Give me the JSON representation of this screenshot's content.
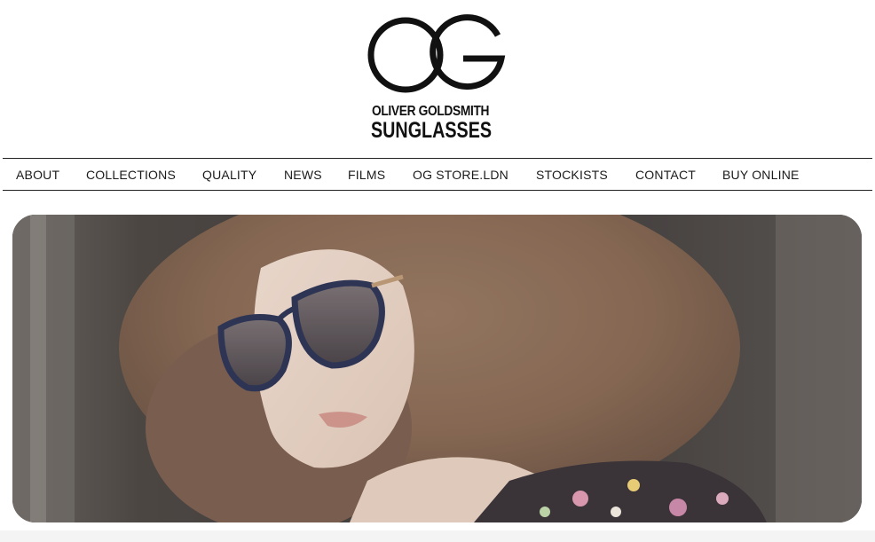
{
  "brand": {
    "monogram": "OG",
    "line1": "OLIVER GOLDSMITH",
    "line2": "SUNGLASSES"
  },
  "nav": {
    "items": [
      {
        "label": "ABOUT"
      },
      {
        "label": "COLLECTIONS"
      },
      {
        "label": "QUALITY"
      },
      {
        "label": "NEWS"
      },
      {
        "label": "FILMS"
      },
      {
        "label": "OG STORE.LDN"
      },
      {
        "label": "STOCKISTS"
      },
      {
        "label": "CONTACT"
      },
      {
        "label": "BUY ONLINE"
      }
    ]
  },
  "hero": {
    "image": "woman-wearing-navy-cat-eye-sunglasses-photo"
  },
  "colors": {
    "text": "#1a1a1a",
    "background": "#ffffff",
    "rule": "#222222"
  }
}
